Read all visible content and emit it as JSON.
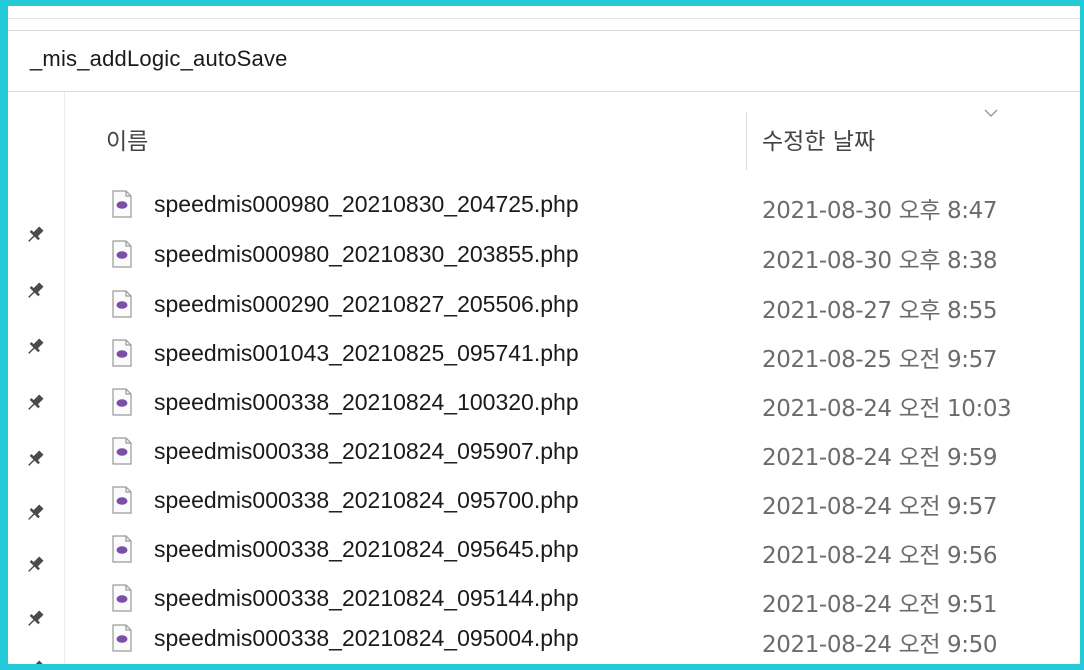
{
  "path": {
    "folder": "_mis_addLogic_autoSave"
  },
  "columns": {
    "name": "이름",
    "modified": "수정한 날짜"
  },
  "icons": {
    "sort": "chevron-down-icon",
    "pin": "pin-icon",
    "file": "php-file-icon"
  },
  "colors": {
    "frame": "#22c9d6",
    "file_icon": "#7b4fa8",
    "date_text": "#6b6b6b"
  },
  "files": [
    {
      "name": "speedmis000980_20210830_204725.php",
      "modified": "2021-08-30 오후 8:47"
    },
    {
      "name": "speedmis000980_20210830_203855.php",
      "modified": "2021-08-30 오후 8:38"
    },
    {
      "name": "speedmis000290_20210827_205506.php",
      "modified": "2021-08-27 오후 8:55"
    },
    {
      "name": "speedmis001043_20210825_095741.php",
      "modified": "2021-08-25 오전 9:57"
    },
    {
      "name": "speedmis000338_20210824_100320.php",
      "modified": "2021-08-24 오전 10:03"
    },
    {
      "name": "speedmis000338_20210824_095907.php",
      "modified": "2021-08-24 오전 9:59"
    },
    {
      "name": "speedmis000338_20210824_095700.php",
      "modified": "2021-08-24 오전 9:57"
    },
    {
      "name": "speedmis000338_20210824_095645.php",
      "modified": "2021-08-24 오전 9:56"
    },
    {
      "name": "speedmis000338_20210824_095144.php",
      "modified": "2021-08-24 오전 9:51"
    },
    {
      "name": "speedmis000338_20210824_095004.php",
      "modified": "2021-08-24 오전 9:50"
    }
  ]
}
